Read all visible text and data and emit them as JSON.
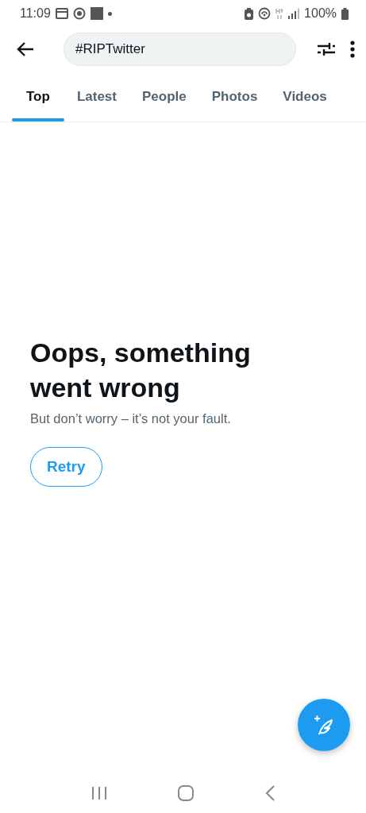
{
  "status_bar": {
    "time": "11:09",
    "battery": "100%"
  },
  "search": {
    "value": "#RIPTwitter"
  },
  "tabs": [
    {
      "label": "Top",
      "selected": true
    },
    {
      "label": "Latest",
      "selected": false
    },
    {
      "label": "People",
      "selected": false
    },
    {
      "label": "Photos",
      "selected": false
    },
    {
      "label": "Videos",
      "selected": false
    }
  ],
  "error": {
    "title": "Oops, something went wrong",
    "message": "But don’t worry – it’s not your fault.",
    "button": "Retry"
  }
}
